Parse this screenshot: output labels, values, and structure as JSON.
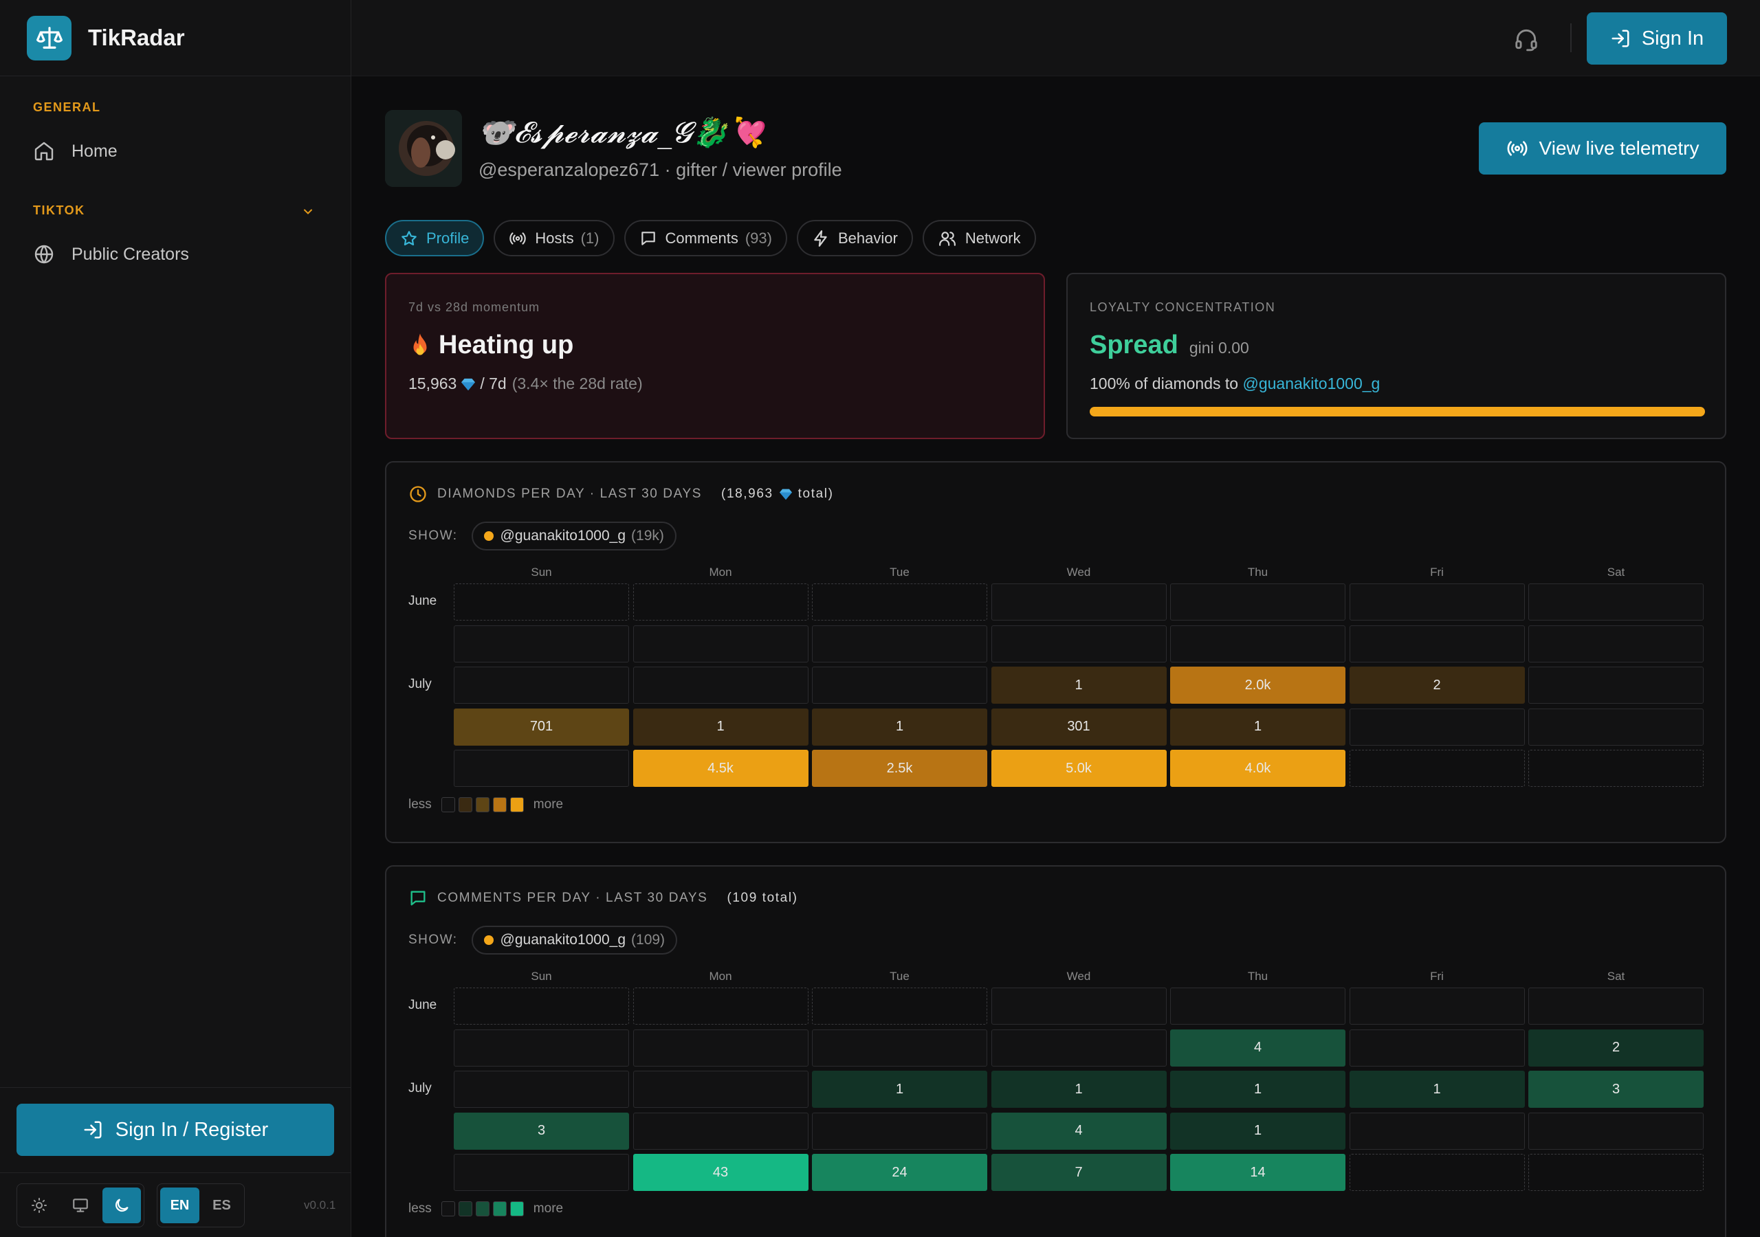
{
  "app": {
    "name": "TikRadar"
  },
  "sidebar": {
    "sections": [
      {
        "label": "GENERAL",
        "items": [
          {
            "label": "Home",
            "icon": "home-icon"
          }
        ]
      },
      {
        "label": "TIKTOK",
        "items": [
          {
            "label": "Public Creators",
            "icon": "globe-icon"
          }
        ]
      }
    ],
    "signin_register": "Sign In / Register",
    "languages": [
      "EN",
      "ES"
    ],
    "active_language": "EN",
    "theme_options": [
      "light",
      "system",
      "dark"
    ],
    "active_theme": "dark",
    "version": "v0.0.1"
  },
  "topbar": {
    "signin": "Sign In"
  },
  "profile": {
    "display_name": "🐨𝓔𝓼𝓹𝓮𝓻𝓪𝓷𝔃𝓪_𝓖🐉💘",
    "handle_line": "@esperanzalopez671 · gifter / viewer profile",
    "telemetry_button": "View live telemetry"
  },
  "tabs": [
    {
      "label": "Profile",
      "count": "",
      "icon": "star-icon",
      "active": true
    },
    {
      "label": "Hosts",
      "count": "(1)",
      "icon": "broadcast-icon",
      "active": false
    },
    {
      "label": "Comments",
      "count": "(93)",
      "icon": "comment-icon",
      "active": false
    },
    {
      "label": "Behavior",
      "count": "",
      "icon": "bolt-icon",
      "active": false
    },
    {
      "label": "Network",
      "count": "",
      "icon": "users-icon",
      "active": false
    }
  ],
  "momentum": {
    "kicker": "7d vs 28d momentum",
    "title": "Heating up",
    "value": "15,963",
    "per": "/ 7d",
    "note": "(3.4× the 28d rate)"
  },
  "loyalty": {
    "kicker": "LOYALTY CONCENTRATION",
    "word": "Spread",
    "gini": "gini 0.00",
    "line_prefix": "100% of diamonds to",
    "line_link": "@guanakito1000_g",
    "share": 1.0
  },
  "diamonds": {
    "title": "DIAMONDS PER DAY · LAST 30 DAYS",
    "total_prefix": "(18,963",
    "total_suffix": "total)",
    "show_label": "SHOW:",
    "series": {
      "name": "@guanakito1000_g",
      "count": "(19k)"
    },
    "days": [
      "Sun",
      "Mon",
      "Tue",
      "Wed",
      "Thu",
      "Fri",
      "Sat"
    ],
    "months": [
      "June",
      "July"
    ],
    "weeks": [
      [
        null,
        null,
        null,
        "",
        "",
        "",
        ""
      ],
      [
        "",
        "",
        "",
        "",
        "",
        "",
        ""
      ],
      [
        "",
        "",
        "",
        "1",
        "2.0k",
        "2",
        ""
      ],
      [
        "701",
        "1",
        "1",
        "301",
        "1",
        "",
        ""
      ],
      [
        "",
        "4.5k",
        "2.5k",
        "5.0k",
        "4.0k",
        null,
        null
      ]
    ],
    "levels": [
      [
        0,
        0,
        0,
        0,
        0,
        0,
        0
      ],
      [
        0,
        0,
        0,
        0,
        0,
        0,
        0
      ],
      [
        0,
        0,
        0,
        1,
        3,
        1,
        0
      ],
      [
        2,
        1,
        1,
        1,
        1,
        0,
        0
      ],
      [
        0,
        4,
        3,
        4,
        4,
        0,
        0
      ]
    ],
    "legend_less": "less",
    "legend_more": "more",
    "palette": [
      "#121213",
      "#3a2a12",
      "#5e4515",
      "#b87414",
      "#eba014"
    ]
  },
  "comments": {
    "title": "COMMENTS PER DAY · LAST 30 DAYS",
    "total_prefix": "(109 total)",
    "total_suffix": "",
    "show_label": "SHOW:",
    "series": {
      "name": "@guanakito1000_g",
      "count": "(109)"
    },
    "days": [
      "Sun",
      "Mon",
      "Tue",
      "Wed",
      "Thu",
      "Fri",
      "Sat"
    ],
    "months": [
      "June",
      "July"
    ],
    "weeks": [
      [
        null,
        null,
        null,
        "",
        "",
        "",
        ""
      ],
      [
        "",
        "",
        "",
        "",
        "4",
        "",
        "2"
      ],
      [
        "",
        "",
        "1",
        "1",
        "1",
        "1",
        "3"
      ],
      [
        "3",
        "",
        "",
        "4",
        "1",
        "",
        ""
      ],
      [
        "",
        "43",
        "24",
        "7",
        "14",
        null,
        null
      ]
    ],
    "levels": [
      [
        0,
        0,
        0,
        0,
        0,
        0,
        0
      ],
      [
        0,
        0,
        0,
        0,
        2,
        0,
        1
      ],
      [
        0,
        0,
        1,
        1,
        1,
        1,
        2
      ],
      [
        2,
        0,
        0,
        2,
        1,
        0,
        0
      ],
      [
        0,
        4,
        3,
        2,
        3,
        0,
        0
      ]
    ],
    "legend_less": "less",
    "legend_more": "more",
    "palette": [
      "#121213",
      "#123326",
      "#17523b",
      "#17855e",
      "#15b884"
    ]
  }
}
